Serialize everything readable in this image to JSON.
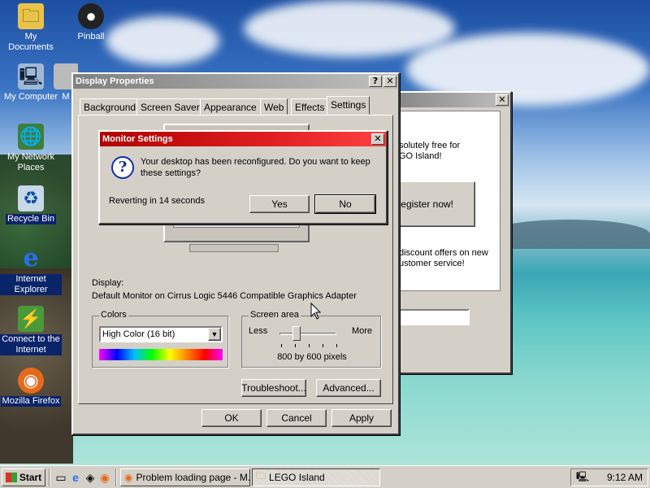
{
  "desktop": {
    "icons": [
      {
        "label": "My Documents",
        "icon": "folder-icon",
        "glyph": "🗀"
      },
      {
        "label": "Pinball",
        "icon": "pinball-icon",
        "glyph": "●"
      },
      {
        "label": "My Computer",
        "icon": "computer-icon",
        "glyph": "🖳"
      },
      {
        "label": "My Network Places",
        "icon": "network-icon",
        "glyph": "🌐"
      },
      {
        "label": "Recycle Bin",
        "icon": "recycle-bin-icon",
        "glyph": "♻"
      },
      {
        "label": "Internet Explorer",
        "icon": "internet-explorer-icon",
        "glyph": "e"
      },
      {
        "label": "Connect to the Internet",
        "icon": "connect-internet-icon",
        "glyph": "⚡"
      },
      {
        "label": "Mozilla Firefox",
        "icon": "firefox-icon",
        "glyph": "◉"
      }
    ],
    "partial_icon_label": "M"
  },
  "lego_window": {
    "text1": "solutely free for",
    "text2": "GO Island!",
    "register_label": "Register now!",
    "text3": "discount offers on new",
    "text4": "ustomer service!"
  },
  "display_properties": {
    "title": "Display Properties",
    "help_btn": "?",
    "close_btn": "✕",
    "tabs": [
      "Background",
      "Screen Saver",
      "Appearance",
      "Web",
      "Effects",
      "Settings"
    ],
    "display_label": "Display:",
    "display_value": "Default Monitor on Cirrus Logic 5446 Compatible Graphics Adapter",
    "colors_label": "Colors",
    "colors_value": "High Color (16 bit)",
    "screen_area_label": "Screen area",
    "less_label": "Less",
    "more_label": "More",
    "resolution": "800 by 600 pixels",
    "troubleshoot_label": "Troubleshoot...",
    "advanced_label": "Advanced...",
    "ok_label": "OK",
    "cancel_label": "Cancel",
    "apply_label": "Apply"
  },
  "monitor_settings": {
    "title": "Monitor Settings",
    "close_btn": "✕",
    "message": "Your desktop has been reconfigured.  Do you want to keep these settings?",
    "countdown": "Reverting in 14 seconds",
    "yes_label": "Yes",
    "no_label": "No"
  },
  "taskbar": {
    "start_label": "Start",
    "tasks": [
      {
        "label": "Problem loading page - M...",
        "icon": "firefox-icon"
      },
      {
        "label": "LEGO Island",
        "icon": "folder-icon"
      }
    ],
    "clock": "9:12 AM"
  }
}
